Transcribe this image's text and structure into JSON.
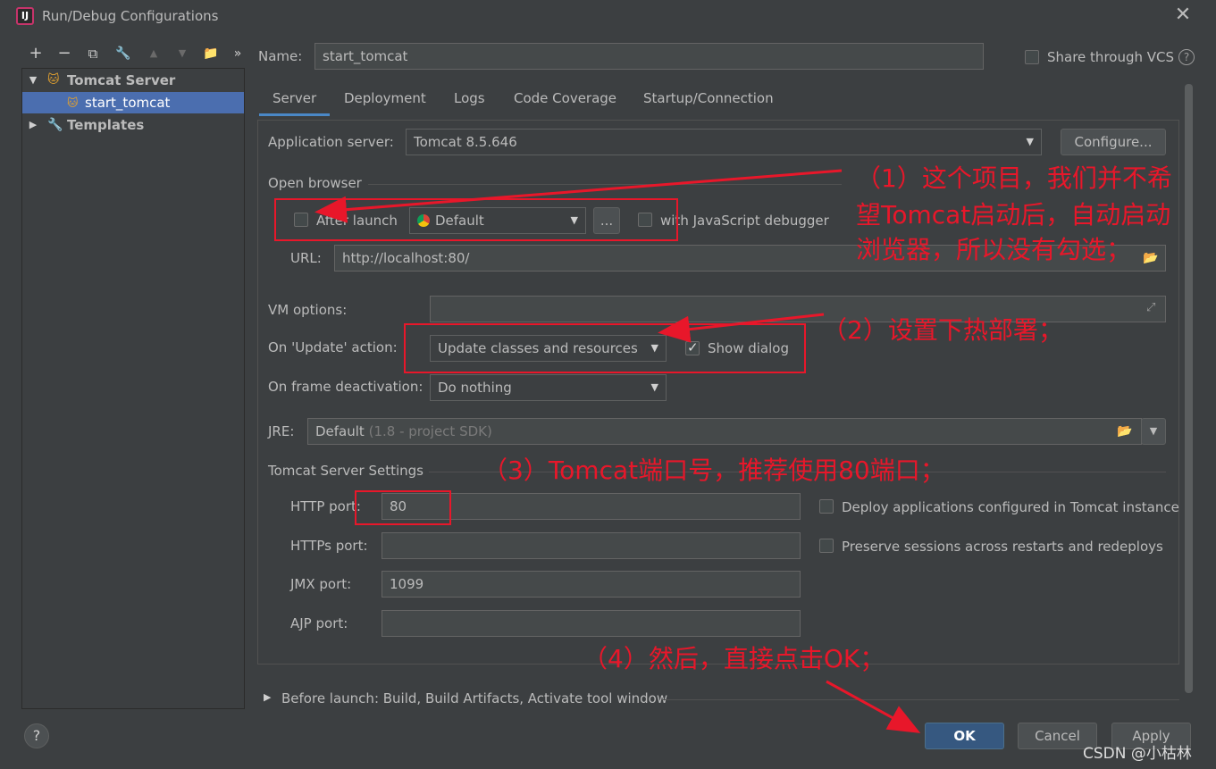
{
  "window": {
    "title": "Run/Debug Configurations"
  },
  "toolbar": {
    "add": "+",
    "remove": "−",
    "copy": "⧉",
    "edit": "🔧",
    "up": "▲",
    "down": "▼",
    "folder": "📁",
    "more": "»"
  },
  "tree": {
    "group": "Tomcat Server",
    "item": "start_tomcat",
    "templates": "Templates"
  },
  "name": {
    "label": "Name:",
    "value": "start_tomcat"
  },
  "share": {
    "label": "Share through VCS"
  },
  "tabs": [
    "Server",
    "Deployment",
    "Logs",
    "Code Coverage",
    "Startup/Connection"
  ],
  "server": {
    "app_server_label": "Application server:",
    "app_server_value": "Tomcat 8.5.646",
    "configure_button": "Configure...",
    "open_browser": "Open browser",
    "after_launch": "After launch",
    "browser": "Default",
    "ellipsis": "...",
    "js_debugger": "with JavaScript debugger",
    "url_label": "URL:",
    "url_value": "http://localhost:80/",
    "vm_label": "VM options:",
    "update_label": "On 'Update' action:",
    "update_value": "Update classes and resources",
    "show_dialog": "Show dialog",
    "frame_label": "On frame deactivation:",
    "frame_value": "Do nothing",
    "jre_label": "JRE:",
    "jre_value": "Default",
    "jre_hint": "(1.8 - project SDK)",
    "tomcat_settings": "Tomcat Server Settings",
    "http_label": "HTTP port:",
    "http_value": "80",
    "https_label": "HTTPs port:",
    "https_value": "",
    "jmx_label": "JMX port:",
    "jmx_value": "1099",
    "ajp_label": "AJP port:",
    "ajp_value": "",
    "deploy_label": "Deploy applications configured in Tomcat instance",
    "preserve_label": "Preserve sessions across restarts and redeploys"
  },
  "before_launch": "Before launch: Build, Build Artifacts, Activate tool window",
  "buttons": {
    "ok": "OK",
    "cancel": "Cancel",
    "apply": "Apply"
  },
  "annotations": {
    "a1_line1": "（1）这个项目，我们并不希",
    "a1_line2": "望Tomcat启动后，自动启动",
    "a1_line3": "浏览器，所以没有勾选；",
    "a2": "（2）设置下热部署；",
    "a3": "（3）Tomcat端口号，推荐使用80端口；",
    "a4": "（4）然后，直接点击OK；"
  },
  "watermark": "CSDN @小枯林",
  "colors": {
    "accent": "#4b6eaf",
    "annotation": "#e8172a",
    "ok_button": "#365880"
  }
}
